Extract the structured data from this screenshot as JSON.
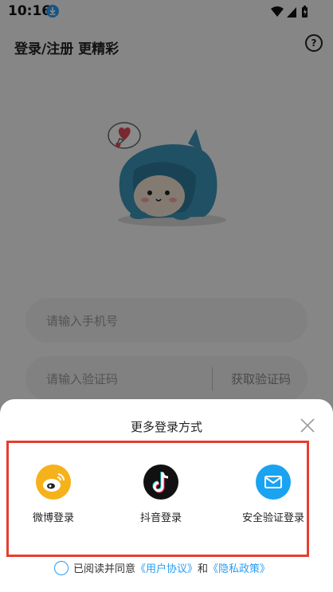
{
  "status_bar": {
    "time": "10:16"
  },
  "header": {
    "title": "登录/注册 更精彩"
  },
  "form": {
    "phone_placeholder": "请输入手机号",
    "code_placeholder": "请输入验证码",
    "get_code_label": "获取验证码"
  },
  "sheet": {
    "title": "更多登录方式",
    "options": [
      {
        "label": "微博登录",
        "icon": "weibo-icon",
        "color": "#f6b21b"
      },
      {
        "label": "抖音登录",
        "icon": "douyin-icon",
        "color": "#111111"
      },
      {
        "label": "安全验证登录",
        "icon": "mail-icon",
        "color": "#1aa3f0"
      }
    ],
    "agree_prefix": "已阅读并同意",
    "user_agreement": "《用户协议》",
    "and_text": "和",
    "privacy_policy": "《隐私政策》"
  },
  "colors": {
    "accent": "#2a9df4",
    "highlight": "#e63e2f"
  }
}
